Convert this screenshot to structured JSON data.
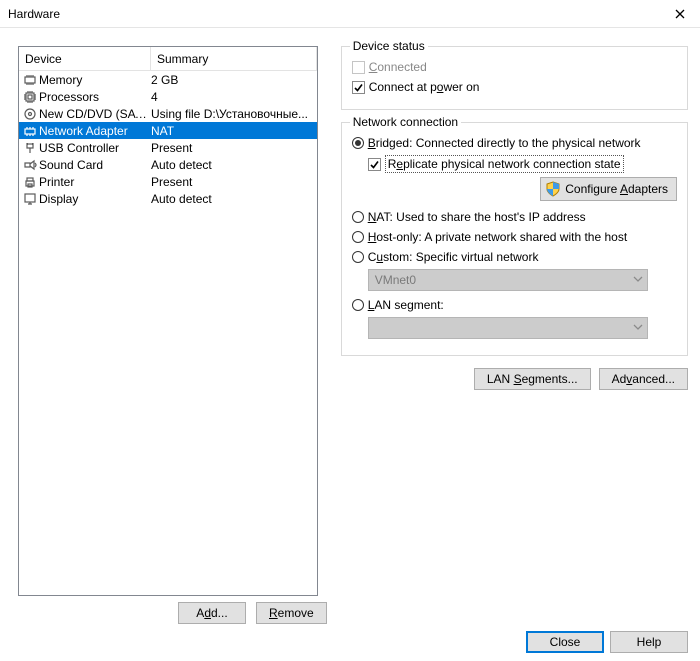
{
  "window": {
    "title": "Hardware"
  },
  "columns": {
    "device": "Device",
    "summary": "Summary"
  },
  "devices": [
    {
      "name": "Memory",
      "summary": "2 GB"
    },
    {
      "name": "Processors",
      "summary": "4"
    },
    {
      "name": "New CD/DVD (SATA)",
      "summary": "Using file D:\\Установочные..."
    },
    {
      "name": "Network Adapter",
      "summary": "NAT"
    },
    {
      "name": "USB Controller",
      "summary": "Present"
    },
    {
      "name": "Sound Card",
      "summary": "Auto detect"
    },
    {
      "name": "Printer",
      "summary": "Present"
    },
    {
      "name": "Display",
      "summary": "Auto detect"
    }
  ],
  "selected_index": 3,
  "list_buttons": {
    "add": {
      "pre": "A",
      "ul": "d",
      "post": "d..."
    },
    "remove": {
      "pre": "",
      "ul": "R",
      "post": "emove"
    }
  },
  "status_group": {
    "legend": "Device status",
    "connected": {
      "pre": "",
      "ul": "C",
      "post": "onnected",
      "checked": false,
      "enabled": false
    },
    "connect_poweron": {
      "label": "Connect at power on",
      "pre": "Connect at p",
      "ul": "o",
      "post": "wer on",
      "checked": true
    }
  },
  "network_group": {
    "legend": "Network connection",
    "bridged": {
      "pre": "",
      "ul": "B",
      "post": "ridged: Connected directly to the physical network",
      "checked": true
    },
    "replicate": {
      "pre": "R",
      "ul": "e",
      "post": "plicate physical network connection state",
      "checked": true
    },
    "configure": {
      "pre": "Configure ",
      "ul": "A",
      "post": "dapters"
    },
    "nat": {
      "pre": "",
      "ul": "N",
      "post": "AT: Used to share the host's IP address",
      "checked": false
    },
    "hostonly": {
      "pre": "",
      "ul": "H",
      "post": "ost-only: A private network shared with the host",
      "checked": false
    },
    "custom": {
      "pre": "C",
      "ul": "u",
      "post": "stom: Specific virtual network",
      "checked": false
    },
    "custom_value": "VMnet0",
    "lanseg": {
      "pre": "",
      "ul": "L",
      "post": "AN segment:",
      "checked": false
    },
    "lanseg_value": ""
  },
  "bottom_buttons": {
    "lan_segments": {
      "pre": "LAN ",
      "ul": "S",
      "post": "egments..."
    },
    "advanced": {
      "pre": "Ad",
      "ul": "v",
      "post": "anced..."
    }
  },
  "footer": {
    "close": "Close",
    "help": "Help"
  }
}
